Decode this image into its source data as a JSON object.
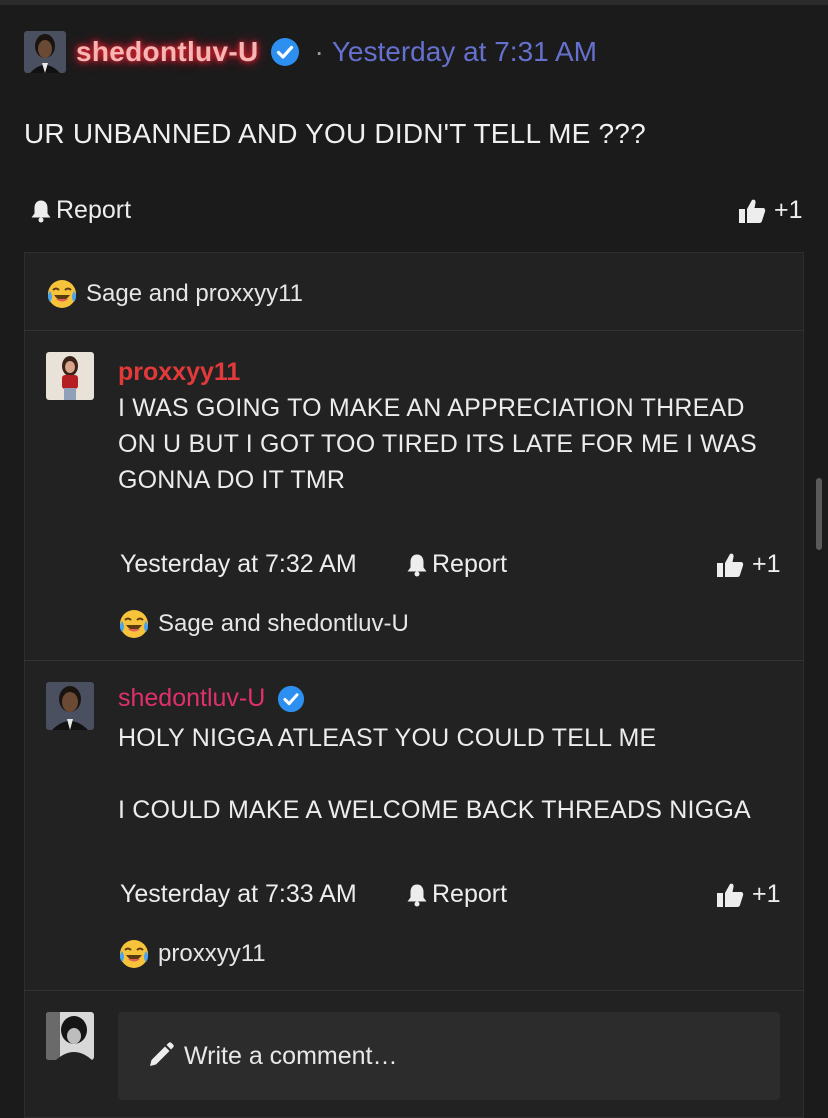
{
  "post": {
    "author": "shedontluv-U",
    "separator": "·",
    "time": "Yesterday at 7:31 AM",
    "body": "UR UNBANNED AND YOU DIDN'T TELL ME ???",
    "report_label": "Report",
    "like_count": "+1"
  },
  "reactions": {
    "summary": "Sage and proxxyy11",
    "emoji": "face-with-tears-of-joy-icon"
  },
  "comments": [
    {
      "author": "proxxyy11",
      "verified": false,
      "lines": [
        "I WAS GOING TO MAKE AN APPRECIATION THREAD",
        "ON U BUT I GOT TOO TIRED ITS LATE FOR ME I WAS",
        "GONNA DO IT TMR"
      ],
      "time": "Yesterday at 7:32 AM",
      "report_label": "Report",
      "like_count": "+1",
      "reactions": "Sage and shedontluv-U"
    },
    {
      "author": "shedontluv-U",
      "verified": true,
      "lines": [
        "HOLY NIGGA ATLEAST YOU COULD TELL ME",
        "",
        "I COULD MAKE A WELCOME BACK THREADS NIGGA"
      ],
      "time": "Yesterday at 7:33 AM",
      "report_label": "Report",
      "like_count": "+1",
      "reactions": "proxxyy11"
    }
  ],
  "composer": {
    "placeholder": "Write a comment…"
  },
  "colors": {
    "accent_link": "#6670cf",
    "verified_blue": "#2d8ff0",
    "name_red": "#e23a3a",
    "name_pink": "#e0306b"
  }
}
